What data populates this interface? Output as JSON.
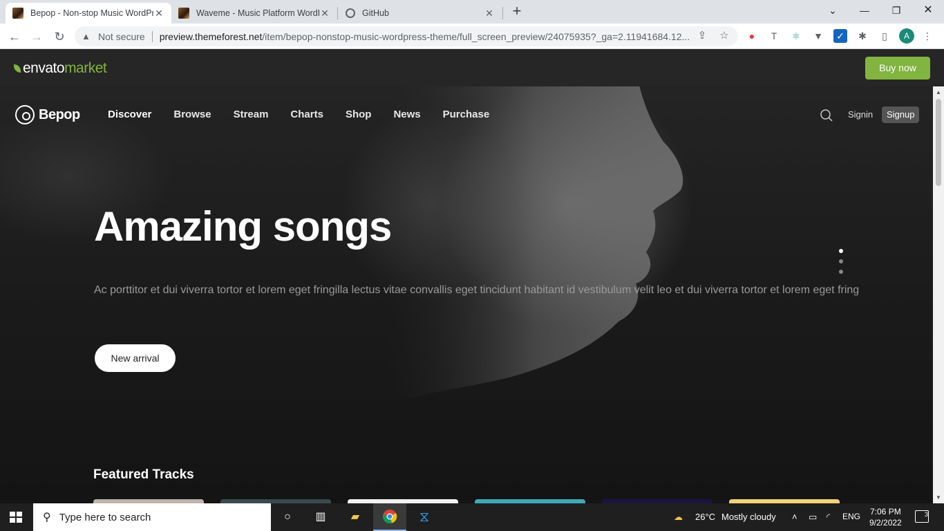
{
  "browser": {
    "tabs": [
      {
        "title": "Bepop - Non-stop Music WordPress Theme",
        "active": true
      },
      {
        "title": "Waveme - Music Platform WordPress Theme",
        "active": false
      },
      {
        "title": "GitHub",
        "active": false
      }
    ],
    "not_secure": "Not secure",
    "url_host": "preview.themeforest.net",
    "url_path": "/item/bepop-nonstop-music-wordpress-theme/full_screen_preview/24075935?_ga=2.11941684.12...",
    "profile_initial": "A"
  },
  "envato": {
    "logo_main": "envato",
    "logo_accent": "market",
    "buy_now": "Buy now",
    "accent_color": "#82b440"
  },
  "site": {
    "brand": "Bepop",
    "nav": [
      "Discover",
      "Browse",
      "Stream",
      "Charts",
      "Shop",
      "News",
      "Purchase"
    ],
    "signin": "Signin",
    "signup": "Signup"
  },
  "hero": {
    "title": "Amazing songs",
    "text": "Ac porttitor et dui viverra tortor et lorem eget fringilla lectus vitae convallis eget tincidunt habitant id vestibulum velit leo et dui viverra tortor et lorem eget fring",
    "cta": "New arrival",
    "slide_count": 3,
    "active_slide": 1
  },
  "featured": {
    "title": "Featured Tracks"
  },
  "taskbar": {
    "search_placeholder": "Type here to search",
    "weather_temp": "26°C",
    "weather_desc": "Mostly cloudy",
    "lang": "ENG",
    "time": "7:06 PM",
    "date": "9/2/2022",
    "notifications": "3"
  }
}
